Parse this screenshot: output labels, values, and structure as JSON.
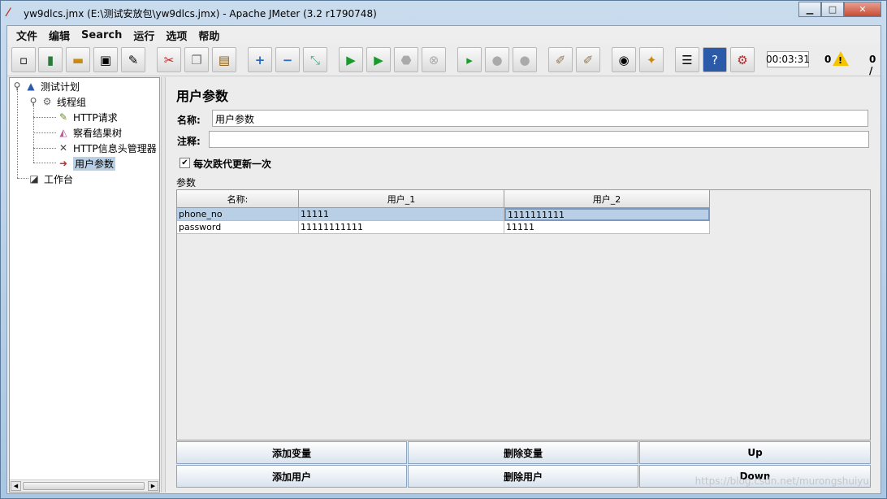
{
  "window": {
    "title": "yw9dlcs.jmx (E:\\测试安放包\\yw9dlcs.jmx) - Apache JMeter (3.2 r1790748)",
    "controls": {
      "minimize": "▁",
      "maximize": "□",
      "close": "✕"
    }
  },
  "menu": [
    "文件",
    "编辑",
    "Search",
    "运行",
    "选项",
    "帮助"
  ],
  "toolbar": {
    "icons": [
      "new-icon",
      "templates-icon",
      "open-icon",
      "save-icon",
      "save-as-icon",
      "cut-icon",
      "copy-icon",
      "paste-icon",
      "expand-icon",
      "collapse-icon",
      "toggle-icon",
      "start-icon",
      "start-no-pause-icon",
      "stop-icon",
      "shutdown-icon",
      "remote-start-icon",
      "remote-stop-icon",
      "remote-exit-icon",
      "clear-icon",
      "clear-all-icon",
      "search-icon",
      "reset-search-icon",
      "function-helper-icon",
      "help-icon",
      "remote-icon"
    ],
    "elapsed_time": "00:03:31",
    "warning_count": "0",
    "active_threads": "0 /"
  },
  "tree": {
    "nodes": [
      {
        "label": "测试计划",
        "icon": "test-plan-icon"
      },
      {
        "label": "线程组",
        "icon": "thread-group-icon"
      },
      {
        "label": "HTTP请求",
        "icon": "http-sampler-icon"
      },
      {
        "label": "察看结果树",
        "icon": "view-results-tree-icon"
      },
      {
        "label": "HTTP信息头管理器",
        "icon": "header-manager-icon"
      },
      {
        "label": "用户参数",
        "icon": "user-parameters-icon"
      },
      {
        "label": "工作台",
        "icon": "workbench-icon"
      }
    ]
  },
  "panel": {
    "title": "用户参数",
    "name_label": "名称:",
    "name_value": "用户参数",
    "comment_label": "注释:",
    "comment_value": "",
    "per_iteration_label": "每次跌代更新一次",
    "per_iteration_checked": true,
    "params_label": "参数"
  },
  "table": {
    "headers": [
      "名称:",
      "用户_1",
      "用户_2"
    ],
    "rows": [
      [
        "phone_no",
        "11111",
        "1111111111"
      ],
      [
        "password",
        "11111111111",
        "11111"
      ]
    ],
    "selected_row": 0
  },
  "buttons": {
    "add_variable": "添加变量",
    "delete_variable": "删除变量",
    "up": "Up",
    "add_user": "添加用户",
    "delete_user": "删除用户",
    "down": "Down"
  },
  "watermark": "https://blog.csdn.net/murongshuiyu"
}
